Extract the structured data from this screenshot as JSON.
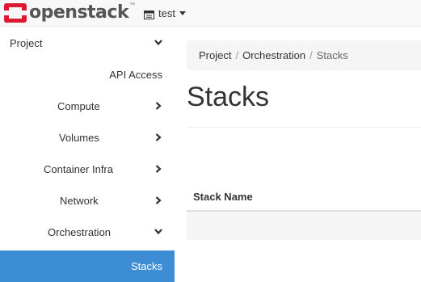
{
  "brand": {
    "name": "openstack",
    "trademark": "™"
  },
  "project_picker": {
    "label": "test"
  },
  "sidebar": {
    "items": [
      {
        "label": "Project",
        "chevron": "down"
      },
      {
        "label": "API Access",
        "chevron": "none"
      },
      {
        "label": "Compute",
        "chevron": "right"
      },
      {
        "label": "Volumes",
        "chevron": "right"
      },
      {
        "label": "Container Infra",
        "chevron": "right"
      },
      {
        "label": "Network",
        "chevron": "right"
      },
      {
        "label": "Orchestration",
        "chevron": "down"
      },
      {
        "label": "Stacks",
        "chevron": "none",
        "active": true
      }
    ]
  },
  "breadcrumb": {
    "items": [
      "Project",
      "Orchestration",
      "Stacks"
    ],
    "separator": "/"
  },
  "page": {
    "title": "Stacks"
  },
  "table": {
    "columns": [
      "Stack Name"
    ]
  },
  "colors": {
    "accent": "#3c8dd4",
    "logo_red": "#da1a32"
  }
}
